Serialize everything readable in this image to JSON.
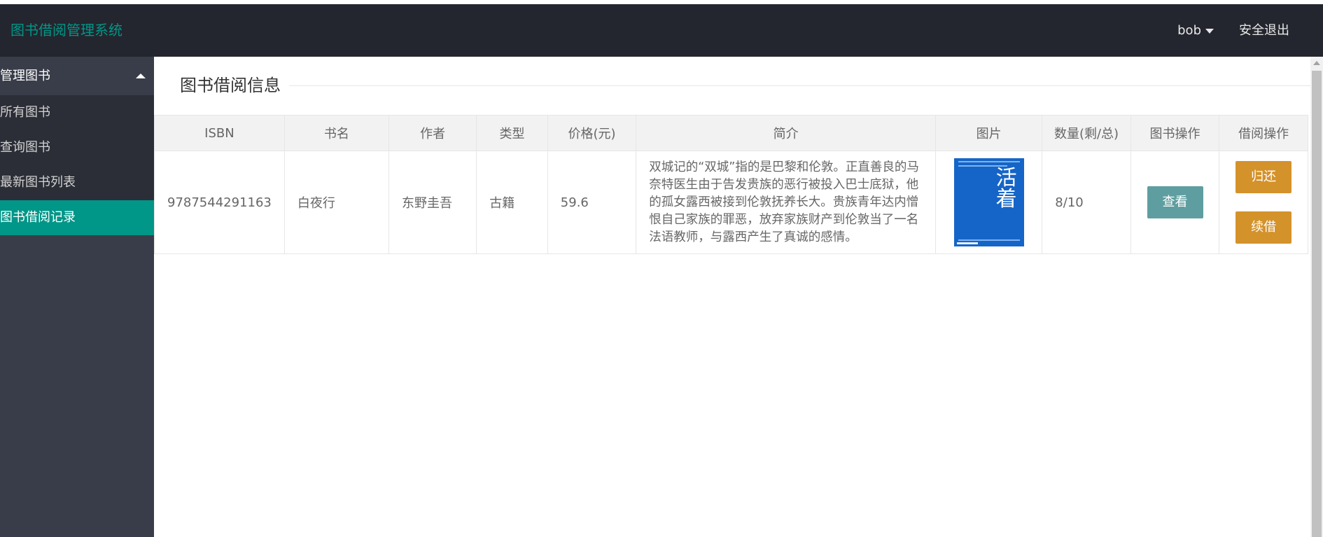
{
  "app": {
    "title": "图书借阅管理系统"
  },
  "header": {
    "user": "bob",
    "logout": "安全退出"
  },
  "sidebar": {
    "group": "管理图书",
    "items": [
      {
        "label": "所有图书"
      },
      {
        "label": "查询图书"
      },
      {
        "label": "最新图书列表"
      },
      {
        "label": "图书借阅记录"
      }
    ]
  },
  "main": {
    "legend": "图书借阅信息",
    "columns": [
      "ISBN",
      "书名",
      "作者",
      "类型",
      "价格(元)",
      "简介",
      "图片",
      "数量(剩/总)",
      "图书操作",
      "借阅操作"
    ],
    "rows": [
      {
        "isbn": "9787544291163",
        "name": "白夜行",
        "author": "东野圭吾",
        "type": "古籍",
        "price": "59.6",
        "desc": "双城记的“双城”指的是巴黎和伦敦。正直善良的马奈特医生由于告发贵族的恶行被投入巴士底狱，他的孤女露西被接到伦敦抚养长大。贵族青年达内憎恨自己家族的罪恶，放弃家族财产到伦敦当了一名法语教师，与露西产生了真诚的感情。",
        "cover_text": "活着",
        "count": "8/10",
        "view": "查看",
        "return": "归还",
        "renew": "续借"
      }
    ]
  },
  "colors": {
    "header_bg": "#23262e",
    "brand": "#009688",
    "sidebar_bg": "#393d49",
    "active": "#009688",
    "view_btn": "#5f9ea0",
    "op_btn": "#d4922b"
  }
}
